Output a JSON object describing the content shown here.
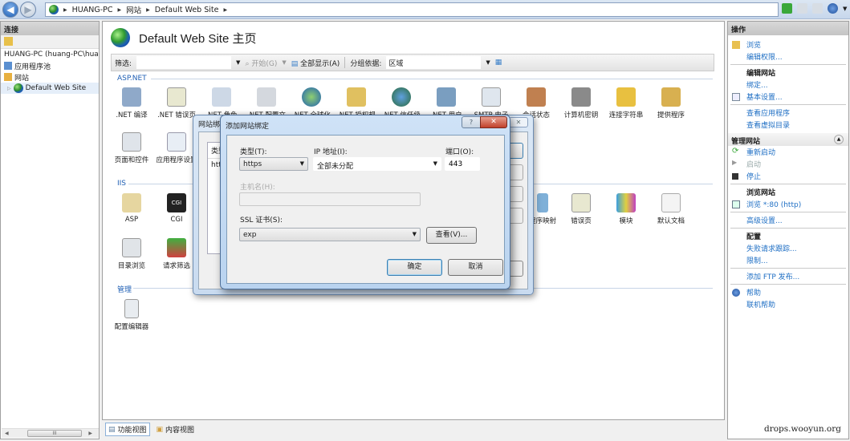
{
  "toolbar": {
    "breadcrumb": [
      "HUANG-PC",
      "网站",
      "Default Web Site"
    ],
    "icons": [
      "connect-icon",
      "stop-icon",
      "home-icon",
      "help-icon"
    ]
  },
  "left": {
    "header": "连接",
    "tree": [
      {
        "label": "HUANG-PC (huang-PC\\hua"
      },
      {
        "label": "应用程序池"
      },
      {
        "label": "网站"
      },
      {
        "label": "Default Web Site"
      }
    ],
    "scroll_thumb": "III"
  },
  "main": {
    "title": "Default Web Site 主页",
    "filter_label": "筛选:",
    "filter_value": "",
    "go_label": "开始(G)",
    "show_all_label": "全部显示(A)",
    "group_label": "分组依据:",
    "group_value": "区域",
    "sections": [
      {
        "name": "ASP.NET",
        "items": [
          ".NET 编译",
          ".NET 错误页",
          ".NET 角色",
          ".NET 配置文",
          ".NET 全球化",
          ".NET 授权规",
          ".NET 信任级",
          ".NET 用户",
          "SMTP 电子",
          "会话状态",
          "计算机密钥",
          "连接字符串",
          "提供程序",
          "页面和控件",
          "应用程序设置"
        ]
      },
      {
        "name": "IIS",
        "items": [
          "ASP",
          "CGI",
          "目录浏览",
          "请求筛选",
          "程序映射",
          "错误页",
          "模块",
          "默认文档"
        ]
      },
      {
        "name": "管理",
        "items": [
          "配置编辑器"
        ]
      }
    ],
    "view_tabs": [
      "功能视图",
      "内容视图"
    ]
  },
  "bg_dialog": {
    "title": "网站绑定",
    "col_type": "类型",
    "row_type": "https"
  },
  "dialog": {
    "title": "添加网站绑定",
    "type_label": "类型(T):",
    "type_value": "https",
    "ip_label": "IP 地址(I):",
    "ip_value": "全部未分配",
    "port_label": "端口(O):",
    "port_value": "443",
    "host_label": "主机名(H):",
    "host_value": "",
    "ssl_label": "SSL 证书(S):",
    "ssl_value": "exp",
    "view_button": "查看(V)...",
    "ok_button": "确定",
    "cancel_button": "取消"
  },
  "right": {
    "header": "操作",
    "actions": {
      "browse": "浏览",
      "edit_perms": "编辑权限...",
      "edit_site": "编辑网站",
      "bindings": "绑定...",
      "basic": "基本设置...",
      "view_apps": "查看应用程序",
      "view_vdirs": "查看虚拟目录",
      "manage_site": "管理网站",
      "restart": "重新启动",
      "start": "启动",
      "stop": "停止",
      "browse_site": "浏览网站",
      "browse_80": "浏览 *:80 (http)",
      "advanced": "高级设置...",
      "config": "配置",
      "failed_req": "失败请求跟踪...",
      "limits": "限制...",
      "add_ftp": "添加 FTP 发布...",
      "help": "帮助",
      "online_help": "联机帮助"
    }
  },
  "watermark": "drops.wooyun.org"
}
